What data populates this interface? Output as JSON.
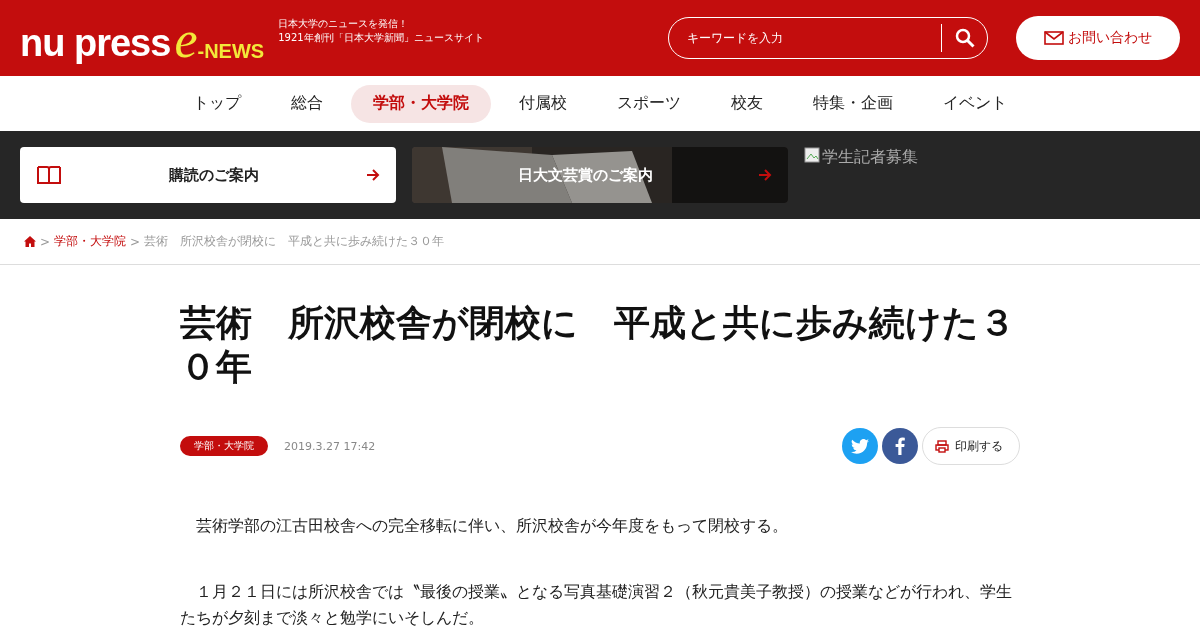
{
  "header": {
    "logo": {
      "main": "nu press",
      "e": "e",
      "news": "-NEWS"
    },
    "tagline": [
      "日本大学のニュースを発信！",
      "1921年創刊「日本大学新聞」ニュースサイト"
    ],
    "search": {
      "placeholder": "キーワードを入力"
    },
    "contact_button": "お問い合わせ"
  },
  "nav": [
    {
      "label": "トップ",
      "selected": false
    },
    {
      "label": "総合",
      "selected": false
    },
    {
      "label": "学部・大学院",
      "selected": true
    },
    {
      "label": "付属校",
      "selected": false
    },
    {
      "label": "スポーツ",
      "selected": false
    },
    {
      "label": "校友",
      "selected": false
    },
    {
      "label": "特集・企画",
      "selected": false
    },
    {
      "label": "イベント",
      "selected": false
    }
  ],
  "banners": [
    {
      "kind": "plain",
      "label": "購読のご案内"
    },
    {
      "label": "日大文芸賞のご案内"
    },
    {
      "kind": "broken-image",
      "label": "学生記者募集"
    }
  ],
  "breadcrumb": [
    {
      "kind": "separator",
      "label": ">"
    },
    {
      "kind": "link",
      "label": "学部・大学院"
    },
    {
      "kind": "separator",
      "label": ">"
    },
    {
      "kind": "current",
      "label": "芸術　所沢校舎が閉校に　平成と共に歩み続けた３０年"
    }
  ],
  "article": {
    "title": "芸術　所沢校舎が閉校に　平成と共に歩み続けた３０年",
    "category": "学部・大学院",
    "date": "2019.3.27 17:42",
    "print_button": "印刷する",
    "paragraphs": [
      "　芸術学部の江古田校舎への完全移転に伴い、所沢校舎が今年度をもって閉校する。",
      "　１月２１日には所沢校舎では〝最後の授業〟となる写真基礎演習２（秋元貴美子教授）の授業などが行われ、学生たちが夕刻まで淡々と勉学にいそしんだ。"
    ]
  }
}
